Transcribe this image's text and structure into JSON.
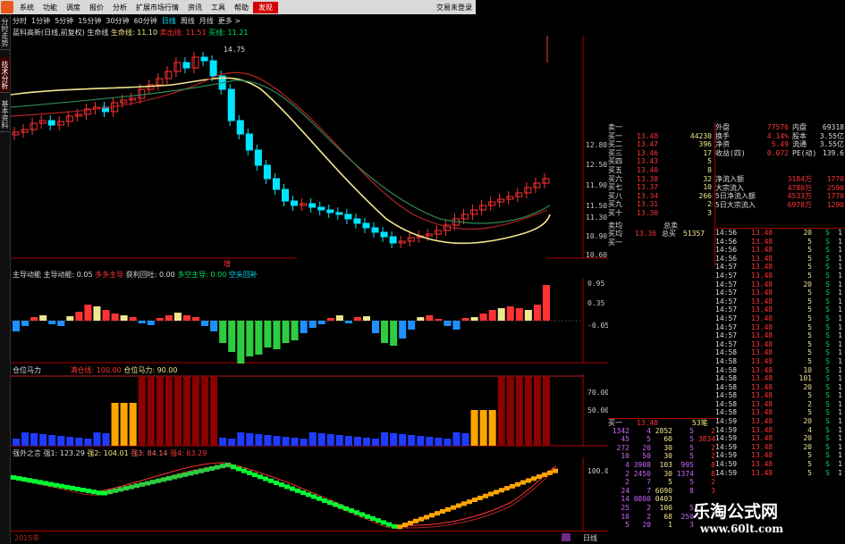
{
  "menubar": {
    "items": [
      "系统",
      "功能",
      "调度",
      "报价",
      "分析",
      "扩展市场行情",
      "资讯",
      "工具",
      "帮助"
    ],
    "highlight": "发现",
    "right": [
      "交易未登录",
      ""
    ]
  },
  "sidebar": {
    "tabs": [
      "分时走势",
      "技术分析",
      "基本资料"
    ]
  },
  "periods": {
    "items": [
      "分时",
      "1分钟",
      "5分钟",
      "15分钟",
      "30分钟",
      "60分钟",
      "日线",
      "周线",
      "月线",
      "更多 >"
    ],
    "active": "日线"
  },
  "main_chart": {
    "title": "蓝科高新(日线,前复权)",
    "label_lifeline": "生命线",
    "lifeline": "生命线: 11.10",
    "marker1": "卖出线: 11.51",
    "marker2": "买线: 11.21",
    "high_label": "14.75",
    "price_ticks": [
      "12.80",
      "12.50",
      "11.90",
      "11.50",
      "11.30",
      "10.90",
      "10.60"
    ]
  },
  "indicator1": {
    "title": "主导动能",
    "value": "主导动能: 0.05",
    "legend": [
      "多多主导",
      "获利回吐: 0.00",
      "多空主导: 0.00",
      "空头回补"
    ],
    "up_marker": "增",
    "ticks": [
      "0.95",
      "0.35",
      "-0.05"
    ]
  },
  "indicator2": {
    "title": "仓位马力",
    "legend": [
      "满仓线: 100.00",
      "仓位马力: 90.00"
    ],
    "ticks": [
      "70.00",
      "50.00"
    ]
  },
  "indicator3": {
    "title": "强外之言",
    "legend": [
      "强1: 123.29",
      "强2: 104.01",
      "强3: 84.14",
      "强4: 63.29"
    ],
    "ticks": [
      "100.0"
    ]
  },
  "bottom_bar": {
    "year": "2015年",
    "tab": "日线"
  },
  "quote": {
    "top": [
      [
        "外盘",
        "77576",
        "内盘",
        "69318"
      ],
      [
        "换手",
        "4.14%",
        "股本",
        "3.55亿"
      ],
      [
        "净资",
        "5.49",
        "流通",
        "3.55亿"
      ],
      [
        "收益(四)",
        "0.072",
        "PE(动)",
        "139.6"
      ]
    ],
    "flows": [
      [
        "净流入额",
        "3184万",
        "1770"
      ],
      [
        "大宗流入",
        "4780万",
        "2590"
      ],
      [
        "5日净流入额",
        "4533万",
        "1770"
      ],
      [
        "5日大宗流入",
        "6978万",
        "1290"
      ]
    ],
    "sell_top": [
      "卖一",
      "13.48",
      "44230"
    ],
    "book": [
      [
        "买一",
        "13.48",
        "44230"
      ],
      [
        "买二",
        "13.47",
        "396"
      ],
      [
        "买三",
        "13.46",
        "17"
      ],
      [
        "买四",
        "13.43",
        "5"
      ],
      [
        "买五",
        "13.40",
        "8"
      ],
      [
        "买六",
        "13.38",
        "32"
      ],
      [
        "买七",
        "13.37",
        "10"
      ],
      [
        "买八",
        "13.34",
        "266"
      ],
      [
        "买九",
        "13.31",
        "2"
      ],
      [
        "买十",
        "13.30",
        "3"
      ]
    ],
    "avg_sell": "卖均",
    "avg_buy": "买均",
    "avg_buy_value": "13.36",
    "total_sell": "总卖",
    "total_buy": "总买",
    "total_buy_value": "51357",
    "buy_one_label": "买一",
    "buy1_line": [
      "买一",
      "13.48",
      "53笔"
    ],
    "queue": [
      [
        "1342",
        "4",
        "2852",
        "5",
        "2"
      ],
      [
        "45",
        "5",
        "60",
        "5",
        "3834"
      ],
      [
        "272",
        "20",
        "30",
        "5",
        "2"
      ],
      [
        "10",
        "50",
        "30",
        "5",
        "2"
      ],
      [
        "4",
        "3908",
        "103",
        "995",
        "8"
      ],
      [
        "2",
        "2450",
        "30",
        "1374",
        "8"
      ],
      [
        "2",
        "7",
        "5",
        "5",
        "2"
      ],
      [
        "24",
        "7",
        "6090",
        "8",
        "3"
      ],
      [
        "14",
        "0800",
        "0403",
        "",
        ""
      ],
      [
        "25",
        "2",
        "100",
        "5",
        ""
      ],
      [
        "10",
        "2",
        "68",
        "250",
        ""
      ],
      [
        "5",
        "20",
        "1",
        "3",
        ""
      ]
    ],
    "ticks": [
      [
        "14:56",
        "13.48",
        "20",
        "S",
        "1"
      ],
      [
        "14:56",
        "13.48",
        "5",
        "S",
        "1"
      ],
      [
        "14:56",
        "13.48",
        "5",
        "S",
        "1"
      ],
      [
        "14:56",
        "13.48",
        "5",
        "S",
        "1"
      ],
      [
        "14:57",
        "13.48",
        "5",
        "S",
        "1"
      ],
      [
        "14:57",
        "13.48",
        "5",
        "S",
        "1"
      ],
      [
        "14:57",
        "13.48",
        "20",
        "S",
        "1"
      ],
      [
        "14:57",
        "13.48",
        "5",
        "S",
        "1"
      ],
      [
        "14:57",
        "13.48",
        "5",
        "S",
        "1"
      ],
      [
        "14:57",
        "13.48",
        "5",
        "S",
        "1"
      ],
      [
        "14:57",
        "13.48",
        "5",
        "S",
        "1"
      ],
      [
        "14:57",
        "13.48",
        "5",
        "S",
        "1"
      ],
      [
        "14:57",
        "13.48",
        "5",
        "S",
        "1"
      ],
      [
        "14:57",
        "13.48",
        "5",
        "S",
        "1"
      ],
      [
        "14:58",
        "13.48",
        "5",
        "S",
        "1"
      ],
      [
        "14:58",
        "13.48",
        "5",
        "S",
        "1"
      ],
      [
        "14:58",
        "13.48",
        "10",
        "S",
        "1"
      ],
      [
        "14:58",
        "13.48",
        "101",
        "S",
        "1"
      ],
      [
        "14:58",
        "13.48",
        "20",
        "S",
        "1"
      ],
      [
        "14:58",
        "13.48",
        "5",
        "S",
        "1"
      ],
      [
        "14:58",
        "13.48",
        "2",
        "S",
        "1"
      ],
      [
        "14:58",
        "13.48",
        "5",
        "S",
        "1"
      ],
      [
        "14:59",
        "13.48",
        "20",
        "S",
        "1"
      ],
      [
        "14:59",
        "13.48",
        "4",
        "S",
        "1"
      ],
      [
        "14:59",
        "13.48",
        "20",
        "S",
        "1"
      ],
      [
        "14:59",
        "13.48",
        "20",
        "S",
        "1"
      ],
      [
        "14:59",
        "13.48",
        "5",
        "S",
        "1"
      ],
      [
        "14:59",
        "13.48",
        "5",
        "S",
        "1"
      ],
      [
        "14:59",
        "13.48",
        "5",
        "S",
        "1"
      ]
    ]
  },
  "watermark": {
    "main": "乐淘公式网",
    "sub": "www.60lt.com"
  },
  "colors": {
    "up": "#ff3333",
    "down": "#00e5ff",
    "accent_red": "#d40000",
    "yellow": "#f0e68c"
  }
}
